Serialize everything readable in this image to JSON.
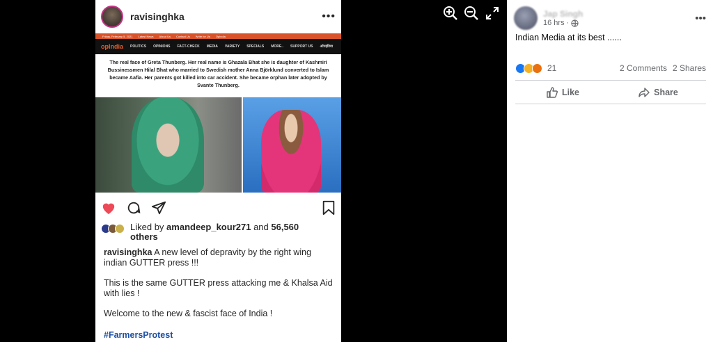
{
  "instagram": {
    "username": "ravisinghka",
    "more_label": "•••",
    "news_site": {
      "topbar_items": [
        "Friday, February 5, 2021",
        "Latest News",
        "About Us",
        "Contact Us",
        "Write for Us",
        "OpIndia"
      ],
      "logo": "opIndia",
      "nav_items": [
        "POLITICS",
        "OPINIONS",
        "FACT-CHECK",
        "MEDIA",
        "VARIETY",
        "SPECIALS",
        "MORE..",
        "SUPPORT US",
        "ऑपइंडिया"
      ],
      "headline": "The real face of Greta Thunberg. Her real name is Ghazala Bhat she is daughter of Kashmiri Bussinessmen Hilal Bhat who married to Swedish mother Anna Björklund converted to Islam became Aafia. Her parents  got killed into car accident. She became orphan later adopted by Svante Thunberg."
    },
    "liked_by_prefix": "Liked by ",
    "liked_by_user": "amandeep_kour271",
    "liked_by_and": " and ",
    "liked_by_count": "56,560",
    "liked_by_others": "others",
    "caption_user": "ravisinghka",
    "caption_1": " A new level of depravity by the right wing indian GUTTER press !!!",
    "caption_2": "This is the same GUTTER press attacking me & Khalsa Aid with lies !",
    "caption_3": "Welcome to the new & fascist face of India !",
    "hashtag": "#FarmersProtest"
  },
  "facebook": {
    "poster_name": "Jap Singh",
    "time": "16 hrs · ",
    "more_label": "•••",
    "post_text": "Indian Media at its best ......",
    "reaction_count": "21",
    "comments": "2 Comments",
    "shares": "2 Shares",
    "like_label": "Like",
    "share_label": "Share",
    "colors": {
      "like_blue": "#1877f2",
      "angry": "#e9710f",
      "sad": "#f7b125",
      "heart": "#ed4956"
    }
  }
}
